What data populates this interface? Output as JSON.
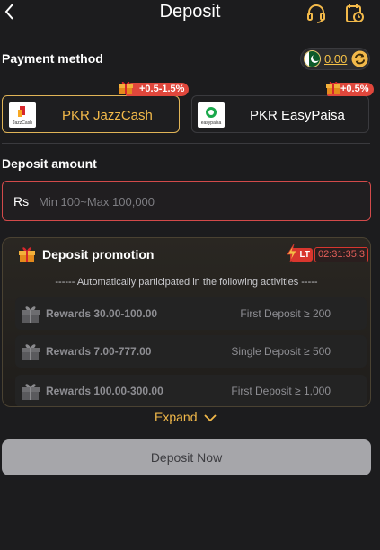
{
  "header": {
    "title": "Deposit",
    "back_icon": "chevron-left-icon",
    "support_icon": "headset-icon",
    "history_icon": "calendar-clock-icon"
  },
  "payment": {
    "label": "Payment method",
    "balance": {
      "value": "0.00",
      "flag_icon": "pakistan-flag-icon",
      "refresh_icon": "refresh-icon"
    },
    "methods": [
      {
        "name": "PKR JazzCash",
        "badge": "+0.5-1.5%",
        "logo_icon": "jazzcash-logo",
        "logo_text": "JazzCash",
        "selected": true
      },
      {
        "name": "PKR EasyPaisa",
        "badge": "+0.5%",
        "logo_icon": "easypaisa-logo",
        "logo_text": "easypaisa",
        "selected": false
      }
    ]
  },
  "amount": {
    "label": "Deposit amount",
    "currency": "Rs",
    "placeholder": "Min 100~Max 100,000",
    "value": ""
  },
  "promotion": {
    "title": "Deposit promotion",
    "timer_tag": "LT",
    "timer": "02:31:35.3",
    "subtitle": "------ Automatically participated in the following activities -----",
    "rewards": [
      {
        "label": "Rewards 30.00-100.00",
        "condition": "First Deposit ≥ 200"
      },
      {
        "label": "Rewards 7.00-777.00",
        "condition": "Single Deposit ≥ 500"
      },
      {
        "label": "Rewards 100.00-300.00",
        "condition": "First Deposit ≥ 1,000"
      }
    ]
  },
  "expand_label": "Expand",
  "submit_label": "Deposit Now",
  "colors": {
    "background": "#1c1c1e",
    "accent": "#f2b94a",
    "badge": "#e0473c",
    "error_border": "#d24a4a",
    "button_disabled": "#a6a6aa"
  }
}
